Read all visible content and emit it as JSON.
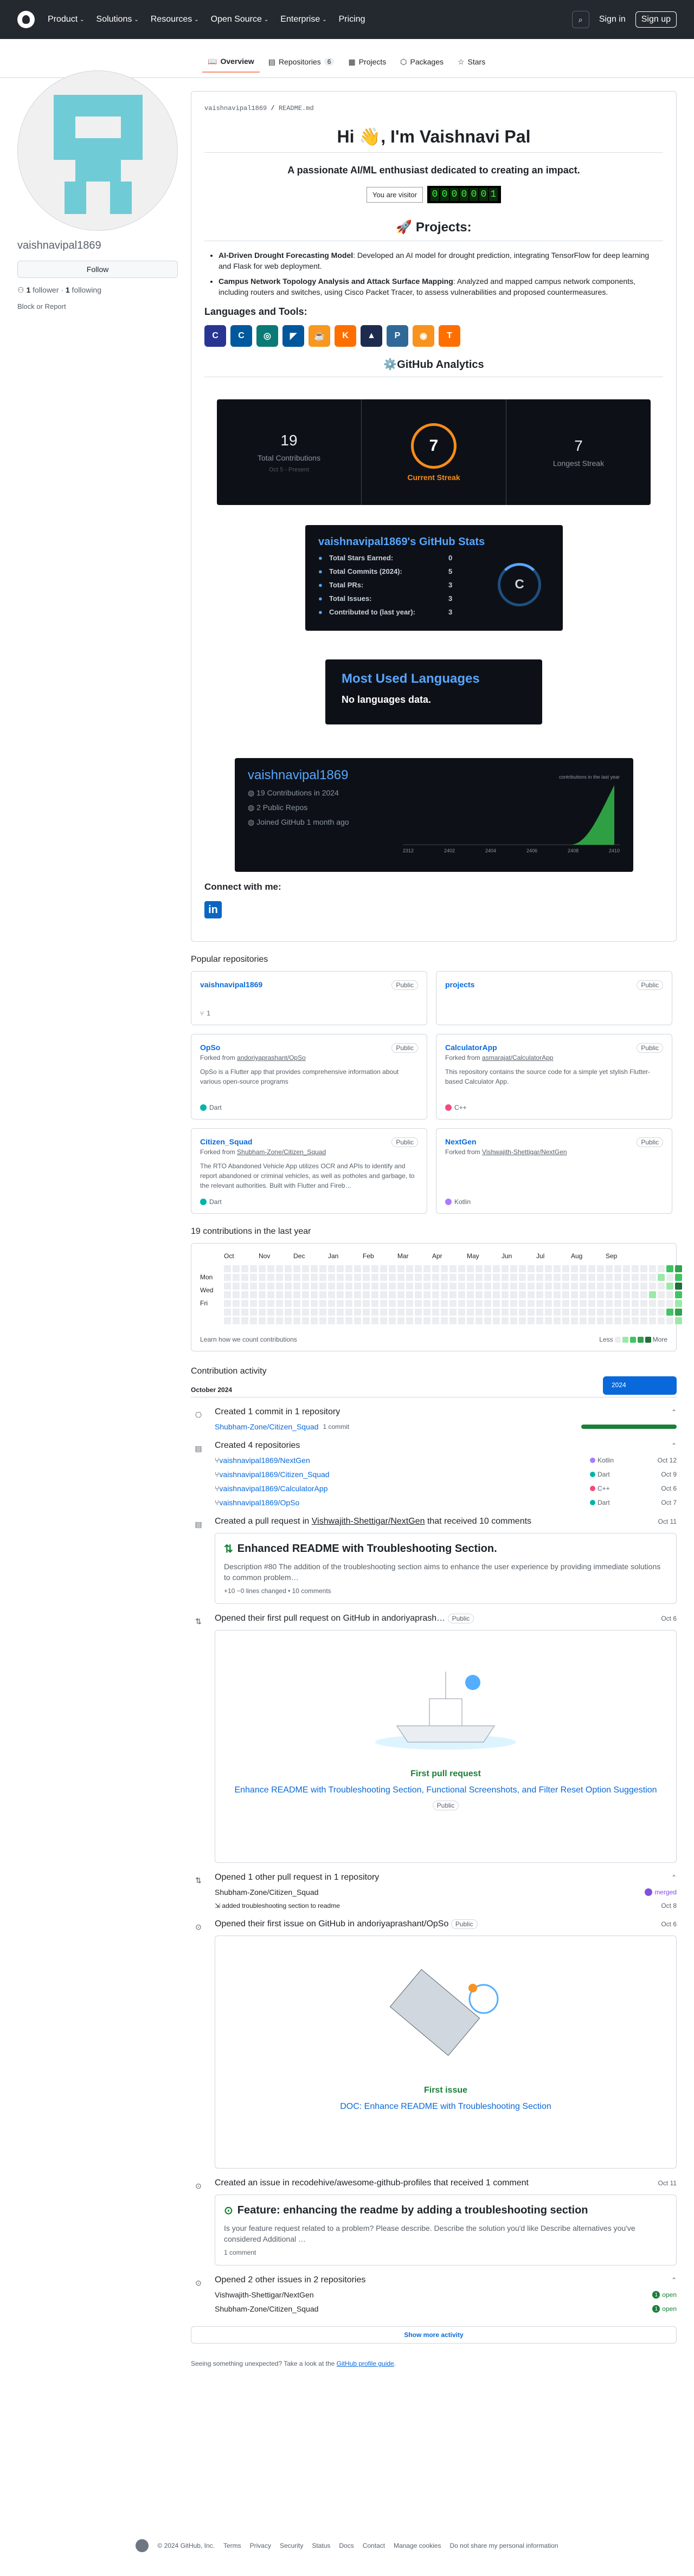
{
  "nav": {
    "items": [
      "Product",
      "Solutions",
      "Resources",
      "Open Source",
      "Enterprise",
      "Pricing"
    ],
    "signin": "Sign in",
    "signup": "Sign up"
  },
  "tabs": [
    {
      "label": "Overview"
    },
    {
      "label": "Repositories",
      "count": "6"
    },
    {
      "label": "Projects"
    },
    {
      "label": "Packages"
    },
    {
      "label": "Stars"
    }
  ],
  "profile": {
    "username": "vaishnavipal1869",
    "follow": "Follow",
    "followers_count": "1",
    "followers_label": "follower",
    "following_count": "1",
    "following_label": "following",
    "block": "Block or Report"
  },
  "readme": {
    "path_user": "vaishnavipal1869",
    "path_file": "README.md",
    "greeting": "Hi 👋, I'm Vaishnavi Pal",
    "tagline": "A passionate AI/ML enthusiast dedicated to creating an impact.",
    "visitor_label": "You are visitor",
    "visitor_digits": [
      "0",
      "0",
      "0",
      "0",
      "0",
      "0",
      "1"
    ],
    "projects_title": "🚀 Projects:",
    "projects": [
      {
        "name": "AI-Driven Drought Forecasting Model",
        "desc": ": Developed an AI model for drought prediction, integrating TensorFlow for deep learning and Flask for web deployment."
      },
      {
        "name": "Campus Network Topology Analysis and Attack Surface Mapping",
        "desc": ": Analyzed and mapped campus network components, including routers and switches, using Cisco Packet Tracer, to assess vulnerabilities and proposed countermeasures."
      }
    ],
    "languages_title": "Languages and Tools:",
    "analytics_title": "⚙️GitHub Analytics",
    "streak": {
      "total": "19",
      "total_label": "Total Contributions",
      "total_sub": "Oct 5 - Present",
      "current": "7",
      "current_label": "Current Streak",
      "longest": "7",
      "longest_label": "Longest Streak"
    },
    "stats": {
      "title": "vaishnavipal1869's GitHub Stats",
      "rows": [
        [
          "Total Stars Earned:",
          "0"
        ],
        [
          "Total Commits (2024):",
          "5"
        ],
        [
          "Total PRs:",
          "3"
        ],
        [
          "Total Issues:",
          "3"
        ],
        [
          "Contributed to (last year):",
          "3"
        ]
      ],
      "grade": "C"
    },
    "langs": {
      "title": "Most Used Languages",
      "sub": "No languages data."
    },
    "activity": {
      "name": "vaishnavipal1869",
      "items": [
        "19 Contributions in 2024",
        "2 Public Repos",
        "Joined GitHub 1 month ago"
      ],
      "chart_label": "contributions in the last year",
      "x": [
        "2312",
        "2402",
        "2404",
        "2406",
        "2408",
        "2410"
      ]
    },
    "connect": "Connect with me:"
  },
  "popular": {
    "title": "Popular repositories",
    "repos": [
      {
        "name": "vaishnavipal1869",
        "vis": "Public",
        "fork": "",
        "desc": "",
        "lang": "",
        "color": "",
        "forks": "1"
      },
      {
        "name": "projects",
        "vis": "Public",
        "fork": "",
        "desc": "",
        "lang": "",
        "color": ""
      },
      {
        "name": "OpSo",
        "vis": "Public",
        "fork_prefix": "Forked from",
        "fork": "andoriyaprashant/OpSo",
        "desc": "OpSo is a Flutter app that provides comprehensive information about various open-source programs",
        "lang": "Dart",
        "color": "#00b4ab"
      },
      {
        "name": "CalculatorApp",
        "vis": "Public",
        "fork_prefix": "Forked from",
        "fork": "asmarajat/CalculatorApp",
        "desc": "This repository contains the source code for a simple yet stylish Flutter-based Calculator App.",
        "lang": "C++",
        "color": "#f34b7d"
      },
      {
        "name": "Citizen_Squad",
        "vis": "Public",
        "fork_prefix": "Forked from",
        "fork": "Shubham-Zone/Citizen_Squad",
        "desc": "The RTO Abandoned Vehicle App utilizes OCR and APIs to identify and report abandoned or criminal vehicles, as well as potholes and garbage, to the relevant authorities. Built with Flutter and Fireb…",
        "lang": "Dart",
        "color": "#00b4ab"
      },
      {
        "name": "NextGen",
        "vis": "Public",
        "fork_prefix": "Forked from",
        "fork": "Vishwajith-Shettigar/NextGen",
        "desc": "",
        "lang": "Kotlin",
        "color": "#a97bff"
      }
    ]
  },
  "contrib": {
    "title": "19 contributions in the last year",
    "months": [
      "Oct",
      "Nov",
      "Dec",
      "Jan",
      "Feb",
      "Mar",
      "Apr",
      "May",
      "Jun",
      "Jul",
      "Aug",
      "Sep"
    ],
    "days": [
      "Mon",
      "Wed",
      "Fri"
    ],
    "learn": "Learn how we count contributions",
    "less": "Less",
    "more": "More",
    "year": "2024"
  },
  "activity": {
    "title": "Contribution activity",
    "month": "October 2024",
    "commits": {
      "head": "Created 1 commit in 1 repository",
      "repo": "Shubham-Zone/Citizen_Squad",
      "meta": "1 commit"
    },
    "repos": {
      "head": "Created 4 repositories",
      "items": [
        {
          "name": "vaishnavipal1869/NextGen",
          "lang": "Kotlin",
          "color": "#a97bff",
          "date": "Oct 12"
        },
        {
          "name": "vaishnavipal1869/Citizen_Squad",
          "lang": "Dart",
          "color": "#00b4ab",
          "date": "Oct 9"
        },
        {
          "name": "vaishnavipal1869/CalculatorApp",
          "lang": "C++",
          "color": "#f34b7d",
          "date": "Oct 6"
        },
        {
          "name": "vaishnavipal1869/OpSo",
          "lang": "Dart",
          "color": "#00b4ab",
          "date": "Oct 7"
        }
      ]
    },
    "pr": {
      "head_pre": "Created a pull request in",
      "head_repo": "Vishwajith-Shettigar/NextGen",
      "head_post": "that received 10 comments",
      "date": "Oct 11",
      "title": "Enhanced README with Troubleshooting Section.",
      "desc": "Description #80 The addition of the troubleshooting section aims to enhance the user experience by providing immediate solutions to common problem…",
      "meta": "+10 −0 lines changed • 10 comments"
    },
    "first_pr": {
      "head": "Opened their first pull request on GitHub in andoriyaprash…",
      "chip": "Public",
      "date": "Oct 6",
      "t": "First pull request",
      "l": "Enhance README with Troubleshooting Section, Functional Screenshots, and Filter Reset Option Suggestion",
      "chip2": "Public"
    },
    "other_pr": {
      "head": "Opened 1 other pull request in 1 repository",
      "repo": "Shubham-Zone/Citizen_Squad",
      "status": "merged",
      "item": "added troubleshooting section to readme",
      "date": "Oct 8"
    },
    "first_issue": {
      "head": "Opened their first issue on GitHub in andoriyaprashant/OpSo",
      "chip": "Public",
      "date": "Oct 6",
      "t": "First issue",
      "l": "DOC: Enhance README with Troubleshooting Section"
    },
    "issue": {
      "head_pre": "Created an issue in",
      "head_repo": "recodehive/awesome-github-profiles",
      "head_post": "that received 1 comment",
      "date": "Oct 11",
      "title": "Feature: enhancing the readme by adding a troubleshooting section",
      "desc": "Is your feature request related to a problem? Please describe. Describe the solution you'd like Describe alternatives you've considered Additional …",
      "meta": "1 comment"
    },
    "other_issues": {
      "head": "Opened 2 other issues in 2 repositories",
      "items": [
        {
          "repo": "Vishwajith-Shettigar/NextGen",
          "n": "1",
          "s": "open"
        },
        {
          "repo": "Shubham-Zone/Citizen_Squad",
          "n": "1",
          "s": "open"
        }
      ]
    },
    "more": "Show more activity",
    "seeing_pre": "Seeing something unexpected? Take a look at the",
    "seeing_link": "GitHub profile guide",
    "seeing_post": "."
  },
  "footer": [
    "© 2024 GitHub, Inc.",
    "Terms",
    "Privacy",
    "Security",
    "Status",
    "Docs",
    "Contact",
    "Manage cookies",
    "Do not share my personal information"
  ]
}
